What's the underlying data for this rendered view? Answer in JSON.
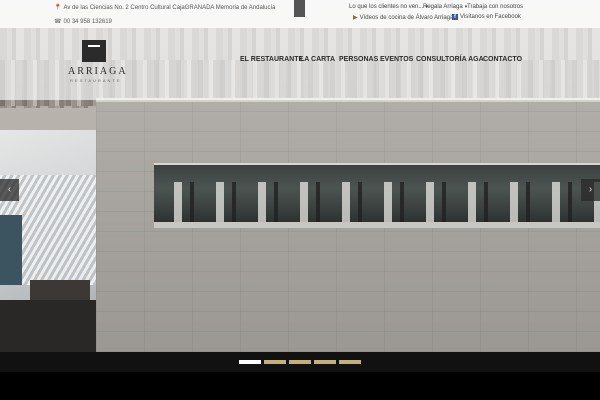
{
  "topbar": {
    "address": "Av de las Ciencias No. 2 Centro Cultural CajaGRANADA Memoria de Andalucía",
    "phone": "00 34 958 132619",
    "links": [
      {
        "label": "Lo que los clientes no ven...",
        "has_dropdown": true
      },
      {
        "label": "Regala Arriaga",
        "has_dropdown": true
      },
      {
        "label": "Trabaja con nosotros",
        "has_dropdown": false
      },
      {
        "label": "Vídeos de cocina de Álvaro Arriaga",
        "icon": "youtube-icon",
        "has_dropdown": true
      },
      {
        "label": "Visítanos en Facebook",
        "icon": "facebook-icon"
      }
    ]
  },
  "logo": {
    "name": "ARRIAGA",
    "subtitle": "RESTAURANTE"
  },
  "nav": {
    "items": [
      "EL RESTAURANTE",
      "LA CARTA",
      "PERSONAS",
      "EVENTOS",
      "CONSULTORÍA AGA",
      "CONTACTO"
    ]
  },
  "slider": {
    "prev_icon": "‹",
    "next_icon": "›",
    "slide_count": 5,
    "active_slide": 1
  },
  "colors": {
    "accent_gold": "#c5b178",
    "dark": "#2b2b2b"
  }
}
